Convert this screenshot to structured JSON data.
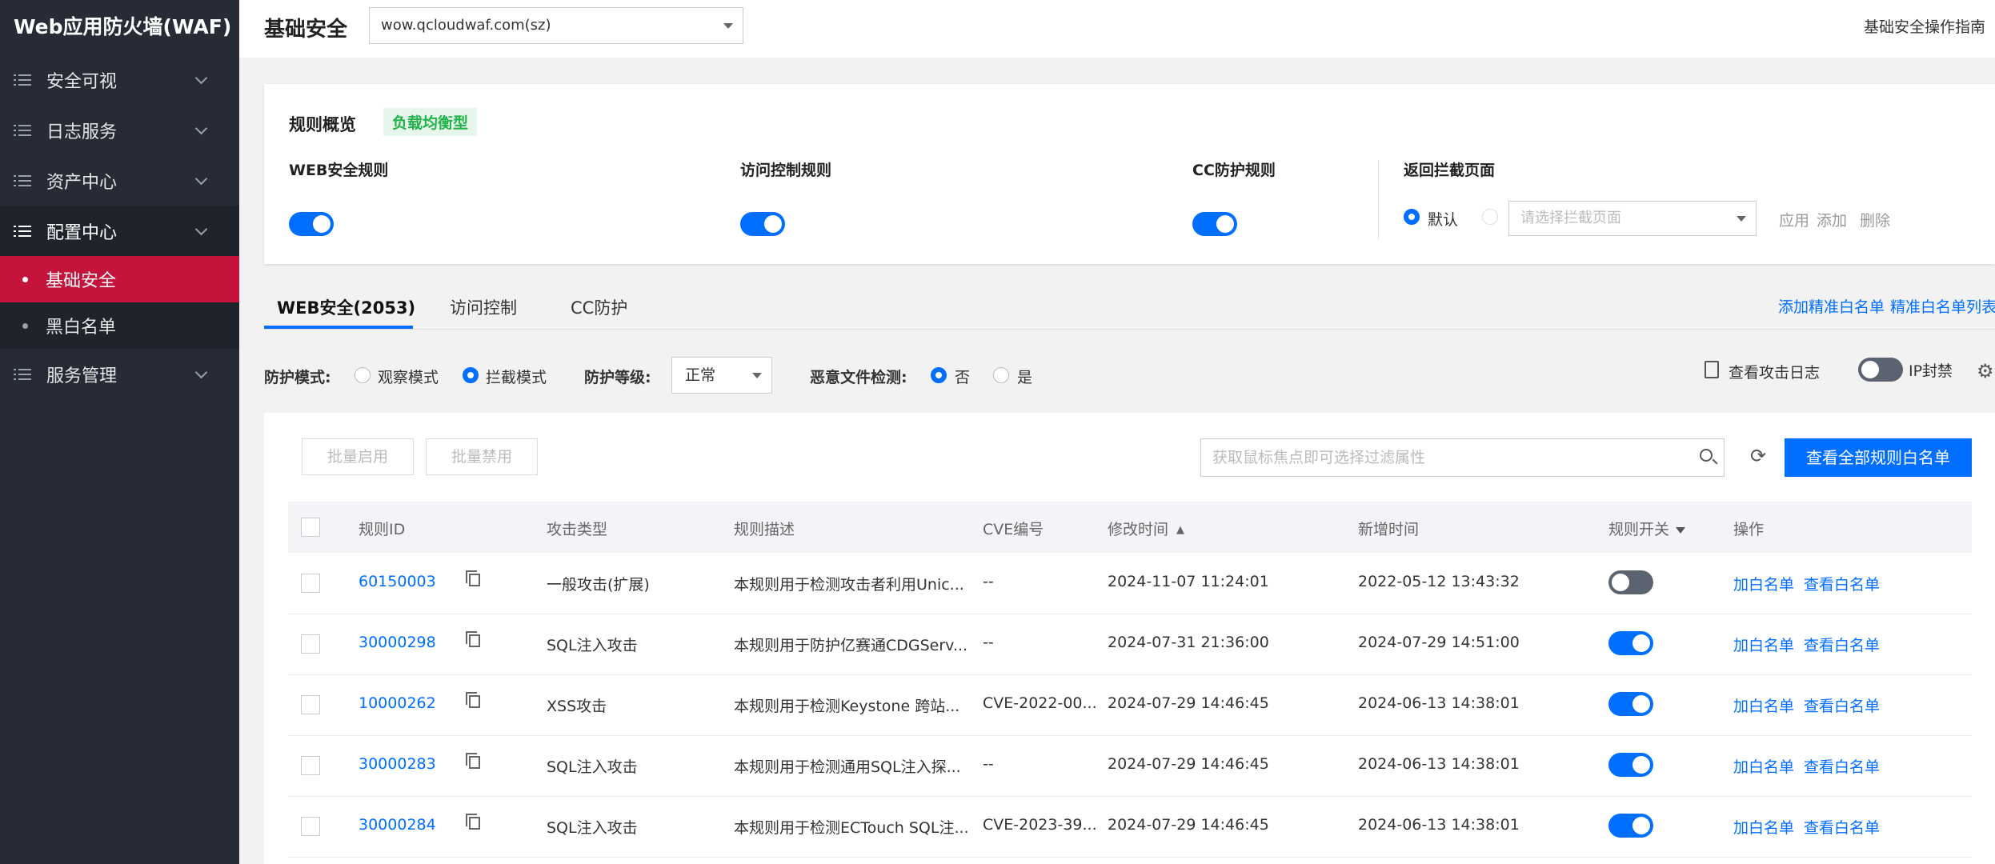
{
  "sidebar": {
    "brand": "Web应用防火墙(WAF)",
    "items": [
      {
        "label": "安全可视"
      },
      {
        "label": "日志服务"
      },
      {
        "label": "资产中心"
      },
      {
        "label": "配置中心"
      },
      {
        "label": "服务管理"
      }
    ],
    "sub_items": [
      {
        "label": "基础安全"
      },
      {
        "label": "黑白名单"
      }
    ]
  },
  "header": {
    "title": "基础安全",
    "domain": "wow.qcloudwaf.com(sz)",
    "guide": "基础安全操作指南"
  },
  "overview": {
    "title": "规则概览",
    "tag": "负载均衡型",
    "web_rule": "WEB安全规则",
    "acl_rule": "访问控制规则",
    "cc_rule": "CC防护规则",
    "block_page": "返回拦截页面",
    "default_label": "默认",
    "block_placeholder": "请选择拦截页面",
    "apply": "应用",
    "add": "添加",
    "delete": "删除"
  },
  "tabs": [
    {
      "label": "WEB安全(2053)"
    },
    {
      "label": "访问控制"
    },
    {
      "label": "CC防护"
    }
  ],
  "links": {
    "add_whitelist": "添加精准白名单",
    "whitelist_list": "精准白名单列表"
  },
  "filters": {
    "mode_label": "防护模式:",
    "observe": "观察模式",
    "block": "拦截模式",
    "level_label": "防护等级:",
    "level_value": "正常",
    "malware_label": "恶意文件检测:",
    "no": "否",
    "yes": "是",
    "attack_log": "查看攻击日志",
    "ip_ban": "IP封禁"
  },
  "table": {
    "batch_enable": "批量启用",
    "batch_disable": "批量禁用",
    "search_placeholder": "获取鼠标焦点即可选择过滤属性",
    "view_all": "查看全部规则白名单",
    "headers": {
      "id": "规则ID",
      "type": "攻击类型",
      "desc": "规则描述",
      "cve": "CVE编号",
      "modified": "修改时间",
      "added": "新增时间",
      "switch": "规则开关",
      "actions": "操作"
    },
    "action_add": "加白名单",
    "action_view": "查看白名单",
    "rows": [
      {
        "id": "60150003",
        "type": "一般攻击(扩展)",
        "desc": "本规则用于检测攻击者利用Unic...",
        "cve": "--",
        "modified": "2024-11-07 11:24:01",
        "added": "2022-05-12 13:43:32",
        "enabled": false
      },
      {
        "id": "30000298",
        "type": "SQL注入攻击",
        "desc": "本规则用于防护亿赛通CDGServ...",
        "cve": "--",
        "modified": "2024-07-31 21:36:00",
        "added": "2024-07-29 14:51:00",
        "enabled": true
      },
      {
        "id": "10000262",
        "type": "XSS攻击",
        "desc": "本规则用于检测Keystone 跨站...",
        "cve": "CVE-2022-00...",
        "modified": "2024-07-29 14:46:45",
        "added": "2024-06-13 14:38:01",
        "enabled": true
      },
      {
        "id": "30000283",
        "type": "SQL注入攻击",
        "desc": "本规则用于检测通用SQL注入探...",
        "cve": "--",
        "modified": "2024-07-29 14:46:45",
        "added": "2024-06-13 14:38:01",
        "enabled": true
      },
      {
        "id": "30000284",
        "type": "SQL注入攻击",
        "desc": "本规则用于检测ECTouch SQL注...",
        "cve": "CVE-2023-39...",
        "modified": "2024-07-29 14:46:45",
        "added": "2024-06-13 14:38:01",
        "enabled": true
      }
    ]
  },
  "colors": {
    "accent": "#006eff",
    "sidebar_bg": "#262b36",
    "active_nav": "#c4143b",
    "tag_green": "#21b34a"
  }
}
